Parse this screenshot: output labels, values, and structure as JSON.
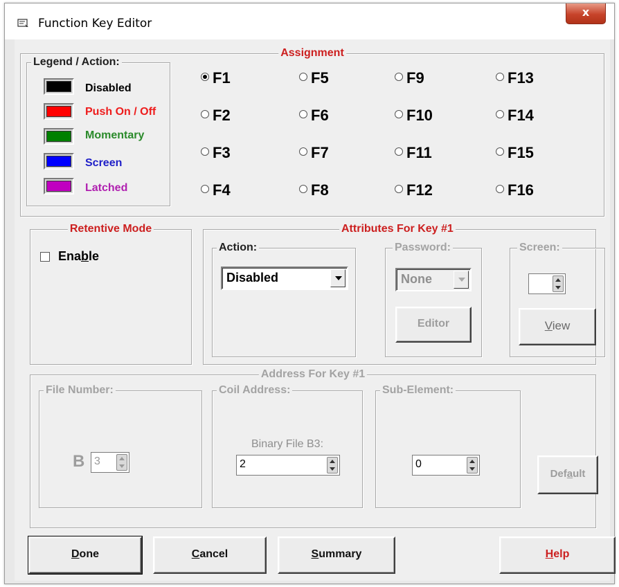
{
  "window": {
    "title": "Function Key Editor",
    "close_glyph": "x"
  },
  "legend_group": {
    "title": "Legend / Action:",
    "items": [
      {
        "label": "Disabled",
        "color": "#000000",
        "text_color": "#000000"
      },
      {
        "label": "Push On / Off",
        "color": "#ff0000",
        "text_color": "#ee1c1c"
      },
      {
        "label": "Momentary",
        "color": "#008000",
        "text_color": "#2a8a2a"
      },
      {
        "label": "Screen",
        "color": "#0000ff",
        "text_color": "#2020c8"
      },
      {
        "label": "Latched",
        "color": "#c000c0",
        "text_color": "#b020b0"
      }
    ]
  },
  "assignment": {
    "title": "Assignment",
    "keys": [
      "F1",
      "F2",
      "F3",
      "F4",
      "F5",
      "F6",
      "F7",
      "F8",
      "F9",
      "F10",
      "F11",
      "F12",
      "F13",
      "F14",
      "F15",
      "F16"
    ],
    "selected": "F1"
  },
  "retentive": {
    "title": "Retentive Mode",
    "enable_pre": "Ena",
    "enable_u": "b",
    "enable_post": "le",
    "checked": false
  },
  "attributes": {
    "title": "Attributes For Key #1",
    "action_label": "Action:",
    "action_value": "Disabled",
    "password_label": "Password:",
    "password_value": "None",
    "editor_button": "Editor",
    "screen_label": "Screen:",
    "screen_value": "",
    "view_u": "V",
    "view_rest": "iew"
  },
  "address": {
    "title": "Address For Key #1",
    "file_number_label": "File Number:",
    "file_prefix": "B",
    "file_value": "3",
    "coil_label": "Coil Address:",
    "coil_caption": "Binary File B3:",
    "coil_value": "2",
    "sub_label": "Sub-Element:",
    "sub_value": "0",
    "default_pre": "Def",
    "default_u": "a",
    "default_post": "ult"
  },
  "buttons": {
    "done_u": "D",
    "done_rest": "one",
    "cancel_u": "C",
    "cancel_rest": "ancel",
    "summary_u": "S",
    "summary_rest": "ummary",
    "help_u": "H",
    "help_rest": "elp"
  }
}
